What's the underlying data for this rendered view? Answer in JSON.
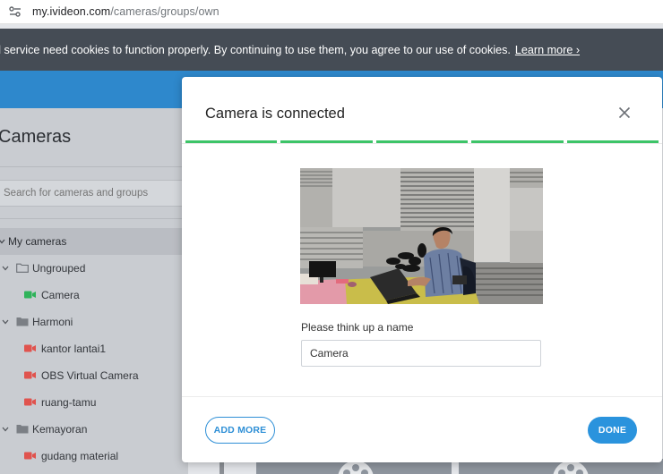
{
  "browser": {
    "url_host": "my.ivideon.com",
    "url_path": "/cameras/groups/own"
  },
  "cookie_bar": {
    "text": "d service need cookies to function properly. By continuing to use them, you agree to our use of cookies.",
    "link": "Learn more ›"
  },
  "sidebar": {
    "title": "Cameras",
    "search_placeholder": "Search for cameras and groups",
    "root_label": "My cameras",
    "tree": [
      {
        "label": "Ungrouped",
        "kind": "group",
        "folder": "outline"
      },
      {
        "label": "Camera",
        "kind": "camera",
        "status_color": "#2fb35a"
      },
      {
        "label": "Harmoni",
        "kind": "group",
        "folder": "filled"
      },
      {
        "label": "kantor lantai1",
        "kind": "camera",
        "status_color": "#e0534e"
      },
      {
        "label": "OBS Virtual Camera",
        "kind": "camera",
        "status_color": "#e0534e"
      },
      {
        "label": "ruang-tamu",
        "kind": "camera",
        "status_color": "#e0534e"
      },
      {
        "label": "Kemayoran",
        "kind": "group",
        "folder": "filled"
      },
      {
        "label": "gudang material",
        "kind": "camera",
        "status_color": "#e0534e"
      }
    ]
  },
  "modal": {
    "title": "Camera is connected",
    "steps_total": 5,
    "steps_done": 5,
    "step_color": "#3dc468",
    "name_label": "Please think up a name",
    "name_value": "Camera",
    "add_more": "ADD MORE",
    "done": "DONE"
  },
  "colors": {
    "accent": "#2a93dd",
    "header": "#2e88cc",
    "cookie_bg": "#454c55"
  }
}
